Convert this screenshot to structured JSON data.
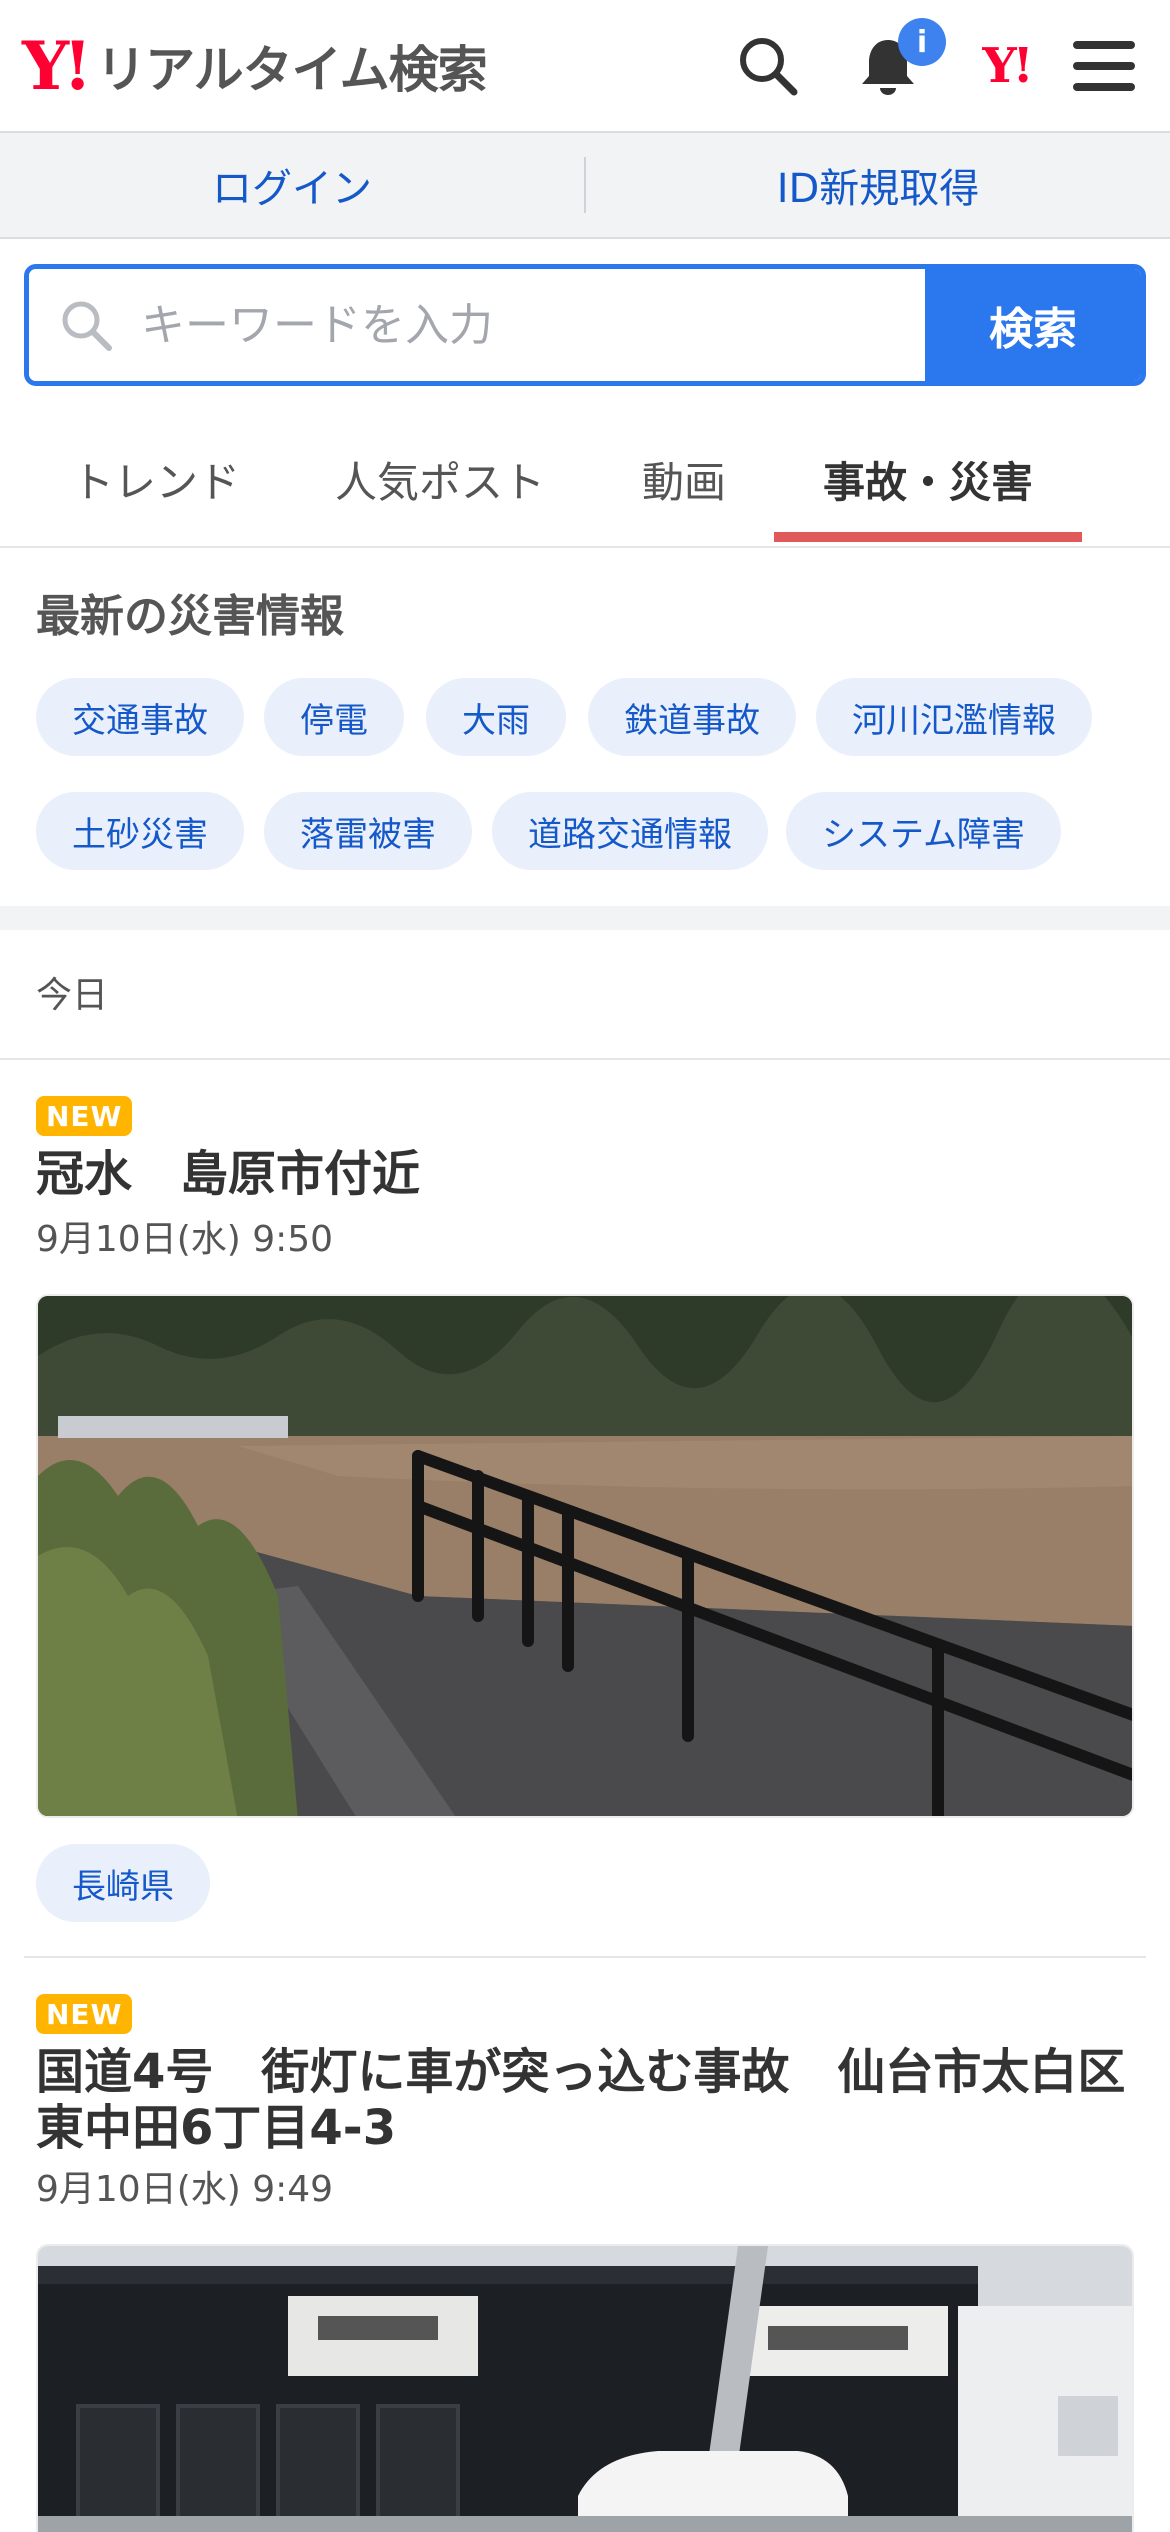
{
  "header": {
    "logo_mark": "Y!",
    "logo_title": "リアルタイム検索",
    "notification_badge": "i",
    "yj_mark": "Y!"
  },
  "login_bar": {
    "login": "ログイン",
    "register": "ID新規取得"
  },
  "search": {
    "placeholder": "キーワードを入力",
    "button": "検索"
  },
  "tabs": [
    "トレンド",
    "人気ポスト",
    "動画",
    "事故・災害"
  ],
  "active_tab": "事故・災害",
  "disaster_section": {
    "title": "最新の災害情報",
    "chips": [
      "交通事故",
      "停電",
      "大雨",
      "鉄道事故",
      "河川氾濫情報",
      "土砂災害",
      "落雷被害",
      "道路交通情報",
      "システム障害"
    ]
  },
  "today_label": "今日",
  "posts": [
    {
      "badge": "NEW",
      "title": "冠水　島原市付近",
      "time": "9月10日(水) 9:50",
      "location": "長崎県"
    },
    {
      "badge": "NEW",
      "title": "国道4号　街灯に車が突っ込む事故　仙台市太白区東中田6丁目4-3",
      "time": "9月10日(水) 9:49"
    }
  ],
  "colors": {
    "brand_red": "#ff0033",
    "accent_blue": "#2b78ee",
    "link_blue": "#1458c9",
    "chip_bg": "#e9f0fb",
    "tab_underline": "#e05a5a",
    "new_badge": "#ffb400"
  }
}
